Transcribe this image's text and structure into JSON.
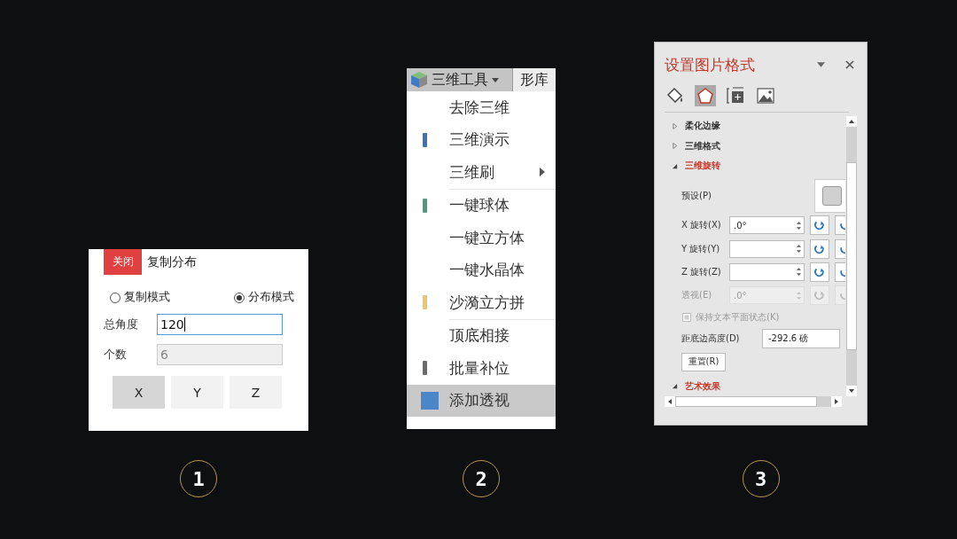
{
  "step_numbers": [
    "1",
    "2",
    "3"
  ],
  "copy_panel": {
    "close_button": "关闭",
    "title": "复制分布",
    "modes": [
      {
        "label": "复制模式",
        "selected": false
      },
      {
        "label": "分布模式",
        "selected": true
      }
    ],
    "fields": [
      {
        "label": "总角度",
        "value": "120",
        "disabled": false
      },
      {
        "label": "个数",
        "value": "6",
        "disabled": true
      }
    ],
    "axis_buttons": [
      {
        "label": "X",
        "selected": true
      },
      {
        "label": "Y",
        "selected": false
      },
      {
        "label": "Z",
        "selected": false
      }
    ]
  },
  "menu_panel": {
    "toolbar": [
      {
        "label": "三维工具",
        "kind": "dropdown"
      },
      {
        "label": "形库",
        "kind": "plain"
      }
    ],
    "items": [
      {
        "label": "去除三维",
        "kind": "plain",
        "submenu": false,
        "separator_before": false,
        "selected": false
      },
      {
        "label": "三维演示",
        "color": "#3d72b8",
        "kind": "bar",
        "submenu": false,
        "separator_before": false,
        "selected": false
      },
      {
        "label": "三维刷",
        "kind": "plain",
        "submenu": true,
        "separator_before": false,
        "selected": false
      },
      {
        "label": "一键球体",
        "color": "#4f9a7c",
        "kind": "bar",
        "submenu": false,
        "separator_before": true,
        "selected": false
      },
      {
        "label": "一键立方体",
        "kind": "plain",
        "submenu": false,
        "separator_before": false,
        "selected": false
      },
      {
        "label": "一键水晶体",
        "kind": "plain",
        "submenu": false,
        "separator_before": false,
        "selected": false
      },
      {
        "label": "沙漪立方拼",
        "color": "#f0c46a",
        "kind": "bar",
        "submenu": false,
        "separator_before": false,
        "selected": false
      },
      {
        "label": "顶底相接",
        "kind": "plain",
        "submenu": false,
        "separator_before": true,
        "selected": false
      },
      {
        "label": "批量补位",
        "color": "#6b6b6b",
        "kind": "bar",
        "submenu": false,
        "separator_before": false,
        "selected": false
      },
      {
        "label": "添加透视",
        "color": "#4a86c8",
        "kind": "square",
        "submenu": false,
        "separator_before": false,
        "selected": true
      }
    ]
  },
  "format_panel": {
    "title": "设置图片格式",
    "tabs": [
      {
        "kind": "fill",
        "selected": false
      },
      {
        "kind": "effects",
        "selected": true
      },
      {
        "kind": "size",
        "selected": false
      },
      {
        "kind": "picture",
        "selected": false
      }
    ],
    "sections": [
      {
        "label": "柔化边缘",
        "expanded": false
      },
      {
        "label": "三维格式",
        "expanded": false
      },
      {
        "label": "三维旋转",
        "expanded": true
      }
    ],
    "preset_label": "预设(P)",
    "rotations": [
      {
        "label": "X 旋转(X)",
        "value": ".0°",
        "disabled": false
      },
      {
        "label": "Y 旋转(Y)",
        "disabled": false
      },
      {
        "label": "Z 旋转(Z)",
        "disabled": false
      },
      {
        "label": "透视(E)",
        "value": ".0°",
        "disabled": true
      }
    ],
    "checkbox": {
      "label": "保持文本平面状态(K)",
      "checked": false,
      "disabled": true
    },
    "distance": {
      "label": "距底边高度(D)",
      "value": "-292.6 磅"
    },
    "reset_button": "重置(R)",
    "last_section": {
      "label": "艺术效果",
      "expanded": true
    }
  }
}
